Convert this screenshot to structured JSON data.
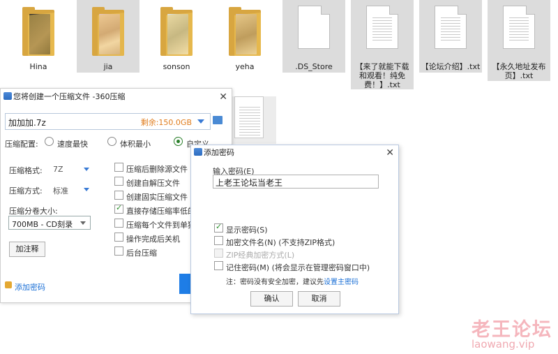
{
  "desktop": {
    "items": [
      {
        "name": "Hina",
        "type": "folder"
      },
      {
        "name": "jia",
        "type": "folder"
      },
      {
        "name": "sonson",
        "type": "folder"
      },
      {
        "name": "yeha",
        "type": "folder"
      },
      {
        "name": ".DS_Store",
        "type": "file"
      },
      {
        "name": "【来了就能下载和观看！纯免费！】.txt",
        "type": "txt",
        "lines": [
          "【来了就能下载",
          "和观看！纯免",
          "费！】.txt"
        ]
      },
      {
        "name": "【论坛介绍】.txt",
        "type": "txt",
        "lines": [
          "【论坛介绍】.txt"
        ]
      },
      {
        "name": "【永久地址发布页】.txt",
        "type": "txt",
        "lines": [
          "【永久地址发布",
          "页】.txt"
        ]
      }
    ]
  },
  "zip_window": {
    "title": "您将创建一个压缩文件 -360压缩",
    "path_value": "加加加.7z",
    "free_space": "剩余:150.0GB",
    "config_label": "压缩配置:",
    "modes": [
      "速度最快",
      "体积最小",
      "自定义"
    ],
    "selected_mode": "自定义",
    "format_label": "压缩格式:",
    "format_value": "7Z",
    "method_label": "压缩方式:",
    "method_value": "标准",
    "volume_label": "压缩分卷大小:",
    "volume_value": "700MB  - CD刻录",
    "comment_button": "加注释",
    "options": [
      {
        "label": "压缩后删除源文件",
        "checked": false
      },
      {
        "label": "创建自解压文件",
        "checked": false
      },
      {
        "label": "创建固实压缩文件",
        "checked": false
      },
      {
        "label": "直接存储压缩率低的文",
        "checked": true
      },
      {
        "label": "压缩每个文件到单独的",
        "checked": false
      },
      {
        "label": "操作完成后关机",
        "checked": false
      },
      {
        "label": "后台压缩",
        "checked": false
      }
    ],
    "add_password_link": "添加密码"
  },
  "password_dialog": {
    "title": "添加密码",
    "input_label": "输入密码(E)",
    "password_value": "上老王论坛当老王",
    "show_password": {
      "label": "显示密码(S)",
      "checked": true
    },
    "encrypt_names": {
      "label": "加密文件名(N) (不支持ZIP格式)",
      "checked": false
    },
    "zip_classic": {
      "label": "ZIP经典加密方式(L)",
      "checked": false,
      "disabled": true
    },
    "remember": {
      "label": "记住密码(M) (将会显示在管理密码窗口中)",
      "checked": false
    },
    "note_prefix": "注：密码没有安全加密，建议先",
    "note_link": "设置主密码",
    "ok": "确认",
    "cancel": "取消"
  },
  "watermark": {
    "title": "老王论坛",
    "url": "laowang.vip"
  }
}
